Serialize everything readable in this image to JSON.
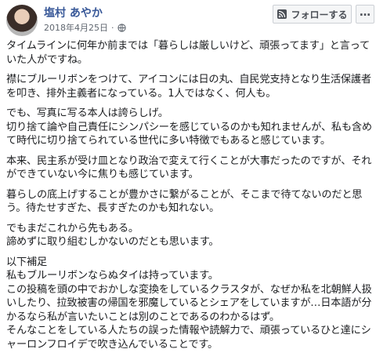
{
  "post": {
    "author_name": "塩村 あやか",
    "date": "2018年4月25日",
    "follow_label": "フォローする",
    "more_label": "…",
    "paragraphs": [
      "タイムラインに何年か前までは「暮らしは厳しいけど、頑張ってます」と言っていた人がですね。",
      "襟にブルーリボンをつけて、アイコンには日の丸、自民党支持となり生活保護者を叩き、排外主義者になっている。1人ではなく、何人も。",
      "でも、写真に写る本人は誇らしげ。\n切り捨て論や自己責任にシンパシーを感じているのかも知れませんが、私も含めて時代に切り捨てられている世代に多い特徴でもあると感じています。",
      "本来、民主系が受け皿となり政治で変えて行くことが大事だったのですが、それができていない今に焦りも感じています。",
      "暮らしの底上げすることが豊かさに繋がることが、そこまで待てないのだと思う。待たせすぎた、長すぎたのかも知れない。",
      "でもまだこれから先もある。\n諦めずに取り組むしかないのだとも思います。",
      "以下補足\n私もブルーリボンならぬタイは持っています。\nこの投稿を頭の中でおかしな変換をしているクラスタが、なぜか私を北朝鮮人扱いしたり、拉致被害の帰国を邪魔しているとシェアをしていますが…日本語が分かるなら私が言いたいことは別のことであるのわかるはず。\nそんなことをしている人たちの誤った情報や読解力で、頑張っているひと達にシャーロンフロイデで吹き込んでいることです。"
    ]
  }
}
